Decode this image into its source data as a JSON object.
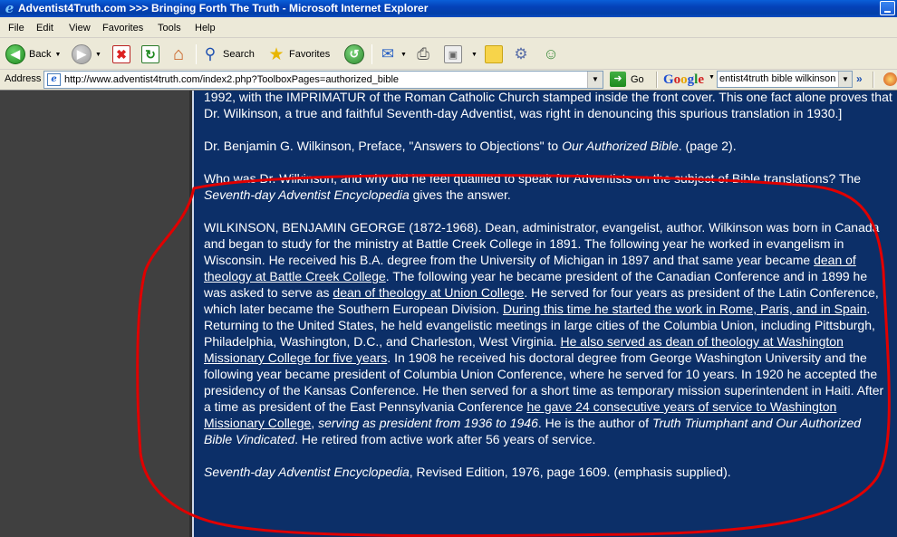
{
  "window": {
    "title": "Adventist4Truth.com >>> Bringing Forth The Truth - Microsoft Internet Explorer"
  },
  "menu": {
    "items": [
      "File",
      "Edit",
      "View",
      "Favorites",
      "Tools",
      "Help"
    ]
  },
  "toolbar": {
    "back_label": "Back",
    "search_label": "Search",
    "favorites_label": "Favorites"
  },
  "address_bar": {
    "label": "Address",
    "url": "http://www.adventist4truth.com/index2.php?ToolboxPages=authorized_bible",
    "go_label": "Go"
  },
  "google_toolbar": {
    "logo": [
      "G",
      "o",
      "o",
      "g",
      "l",
      "e"
    ],
    "query": "entist4truth  bible wilkinson"
  },
  "article": {
    "intro": {
      "text": "1992, with the IMPRIMATUR of the Roman Catholic Church stamped inside the front cover. This one fact alone proves that Dr. Wilkinson, a true and faithful Seventh-day Adventist, was right in denouncing this spurious translation in 1930.]"
    },
    "citation1": {
      "pre": "Dr. Benjamin G. Wilkinson, Preface, \"Answers to Objections\" to ",
      "book": "Our Authorized Bible",
      "post": ". (page 2)."
    },
    "question": {
      "pre": "Who was Dr. Wilkinson, and why did he feel qualified to speak for Adventists on the subject of Bible translations? The ",
      "book": "Seventh-day Adventist Encyclopedia",
      "post": " gives the answer."
    },
    "entry": {
      "s1": "WILKINSON, BENJAMIN GEORGE (1872-1968). Dean, administrator, evangelist, author. Wilkinson was born in Canada and began to study for the ministry at Battle Creek College in 1891. The following year he worked in evangelism in Wisconsin. He received his B.A. degree from the University of Michigan in 1897 and that same year became ",
      "u1": "dean of theology at Battle Creek College",
      "s2": ". The following year he became president of the Canadian Conference and in 1899 he was asked to serve as ",
      "u2": "dean of theology at Union College",
      "s3": ". He served for four years as president of the Latin Conference, which later became the Southern European Division. ",
      "u3": "During this time he started the work in Rome, Paris, and in Spain",
      "s4": ". Returning to the United States, he held evangelistic meetings in large cities of the Columbia Union, including Pittsburgh, Philadelphia, Washington, D.C., and Charleston, West Virginia. ",
      "u4": "He also served as dean of theology at Washington Missionary College for five years",
      "s5": ". In 1908 he received his doctoral degree from George Washington University and the following year became president of Columbia Union Conference, where he served for 10 years. In 1920 he accepted the presidency of the Kansas Conference. He then served for a short time as temporary mission superintendent in Haiti. After a time as president of the East Pennsylvania Conference ",
      "u5": "he gave 24 consecutive years of service to Washington Missionary College",
      "s6": ", ",
      "i1": "serving as president from 1936 to 1946",
      "s7": ". He is the author of ",
      "i2": "Truth Triumphant and Our Authorized Bible Vindicated",
      "s8": ". He retired from active work after 56 years of service."
    },
    "citation2": {
      "book": "Seventh-day Adventist Encyclopedia",
      "post": ", Revised Edition, 1976, page 1609. (emphasis supplied)."
    }
  },
  "colors": {
    "page_background": "#0c2f68",
    "highlight_circle": "#e00000",
    "titlebar": "#0441b8"
  }
}
